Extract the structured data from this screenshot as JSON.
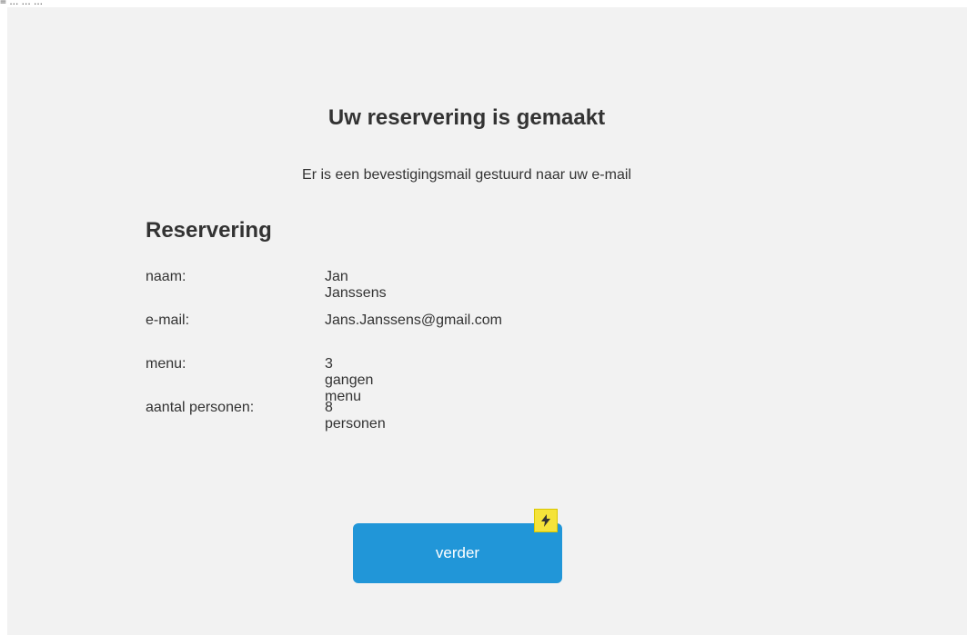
{
  "top_label": "≡ ... ... ...",
  "confirmation": {
    "title": "Uw reservering is gemaakt",
    "subtitle": "Er is een bevestigingsmail gestuurd naar uw e-mail"
  },
  "reservation": {
    "heading": "Reservering",
    "rows": [
      {
        "label": "naam:",
        "value": "Jan Janssens"
      },
      {
        "label": "e-mail:",
        "value": "Jans.Janssens@gmail.com"
      },
      {
        "label": "menu:",
        "value": "3 gangen menu"
      },
      {
        "label": "aantal personen:",
        "value": "8 personen"
      }
    ]
  },
  "actions": {
    "continue_label": "verder"
  },
  "colors": {
    "background": "#f2f2f2",
    "button": "#2196d8",
    "badge": "#f5e33a"
  }
}
